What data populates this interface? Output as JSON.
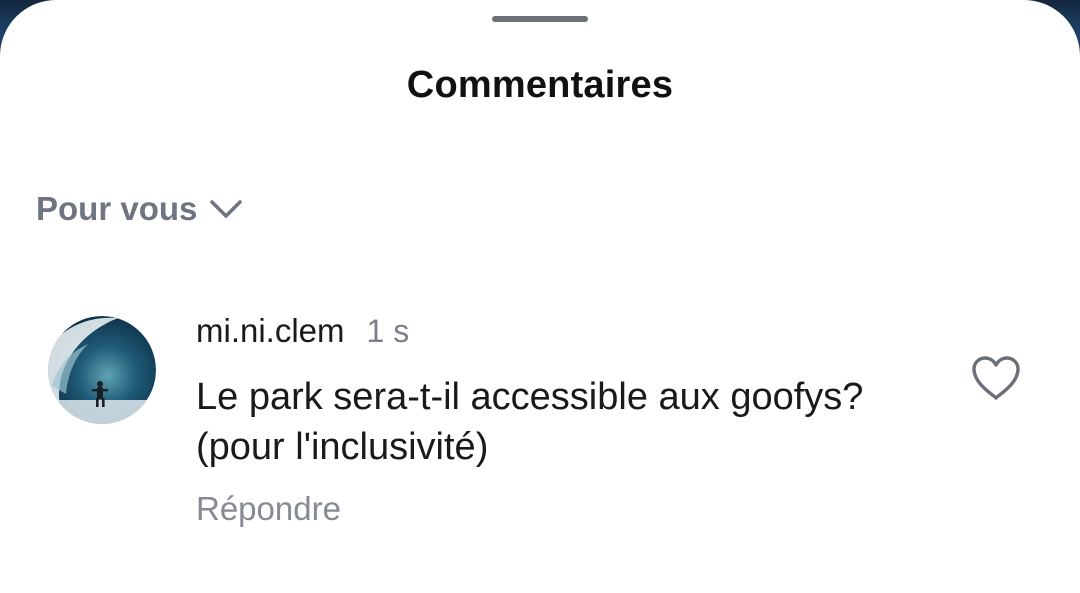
{
  "sheet": {
    "title": "Commentaires"
  },
  "sort": {
    "label": "Pour vous",
    "icon": "chevron-down-icon"
  },
  "comments": [
    {
      "username": "mi.ni.clem",
      "timestamp": "1 s",
      "text": "Le park sera-t-il accessible aux goofys? (pour l'inclusivité)",
      "reply_label": "Répondre",
      "like_icon": "heart-outline-icon",
      "avatar_icon": "surfer-wave-avatar"
    }
  ],
  "colors": {
    "background": "#ffffff",
    "title": "#111111",
    "muted": "#6e7480",
    "text": "#1a1a1a"
  }
}
